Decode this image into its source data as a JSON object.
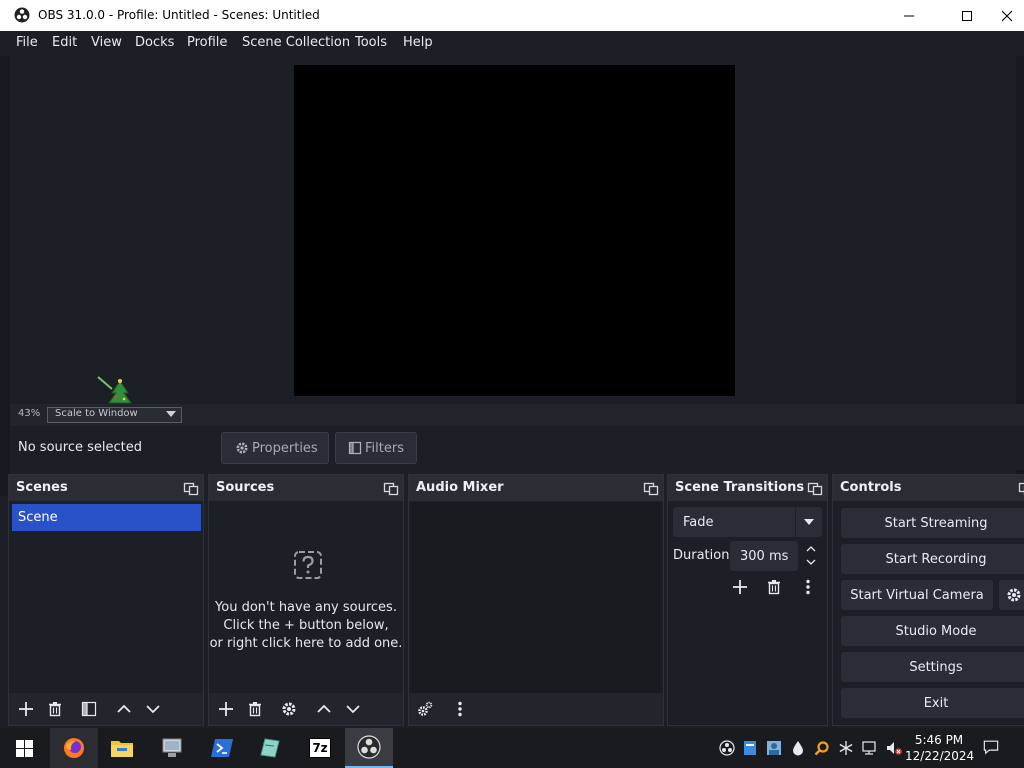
{
  "window": {
    "title": "OBS 31.0.0 - Profile: Untitled - Scenes: Untitled"
  },
  "menu": [
    "File",
    "Edit",
    "View",
    "Docks",
    "Profile",
    "Scene Collection",
    "Tools",
    "Help"
  ],
  "preview": {
    "zoom": "43%",
    "scale_mode": "Scale to Window"
  },
  "source_toolbar": {
    "status": "No source selected",
    "properties_label": "Properties",
    "filters_label": "Filters"
  },
  "docks": {
    "scenes": {
      "title": "Scenes",
      "items": [
        "Scene"
      ]
    },
    "sources": {
      "title": "Sources",
      "empty_line1": "You don't have any sources.",
      "empty_line2": "Click the + button below,",
      "empty_line3": "or right click here to add one."
    },
    "audio_mixer": {
      "title": "Audio Mixer"
    },
    "scene_transitions": {
      "title": "Scene Transitions",
      "transition": "Fade",
      "duration_label": "Duration",
      "duration_value": "300 ms"
    },
    "controls": {
      "title": "Controls",
      "start_streaming": "Start Streaming",
      "start_recording": "Start Recording",
      "start_virtual_camera": "Start Virtual Camera",
      "studio_mode": "Studio Mode",
      "settings": "Settings",
      "exit": "Exit"
    }
  },
  "taskbar": {
    "time": "5:46 PM",
    "date": "12/22/2024",
    "tb_7z": "7z"
  },
  "colors": {
    "scene_selected": "#2951c8",
    "background": "#1d1f26",
    "dock_header": "#2b2d35"
  }
}
